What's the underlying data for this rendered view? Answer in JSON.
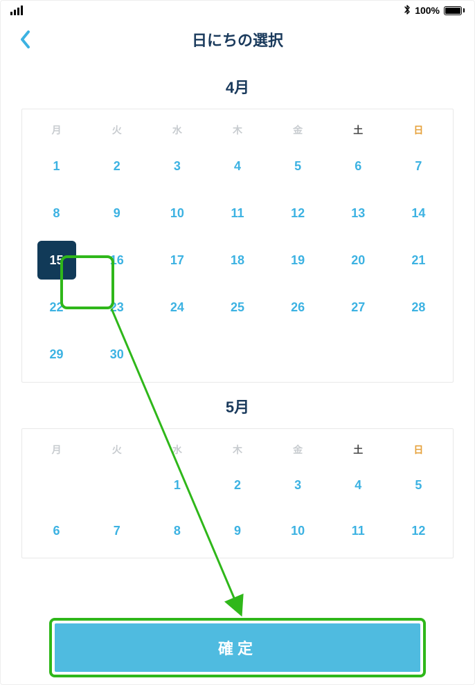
{
  "status": {
    "bluetooth_icon": "bluetooth",
    "battery_pct": "100%"
  },
  "header": {
    "back_icon": "chevron-left",
    "title": "日にちの選択"
  },
  "weekdays": [
    "月",
    "火",
    "水",
    "木",
    "金",
    "土",
    "日"
  ],
  "months": [
    {
      "label": "4月",
      "lead_blanks": 0,
      "days": 30,
      "selected": 15
    },
    {
      "label": "5月",
      "lead_blanks": 2,
      "days": 31,
      "selected": null,
      "visible_rows": 2
    }
  ],
  "confirm_label": "確定",
  "annotation": {
    "highlight_selected_day": true,
    "highlight_confirm_button": true,
    "arrow_from_selected_to_confirm": true,
    "arrow_color": "#2fb71a"
  }
}
